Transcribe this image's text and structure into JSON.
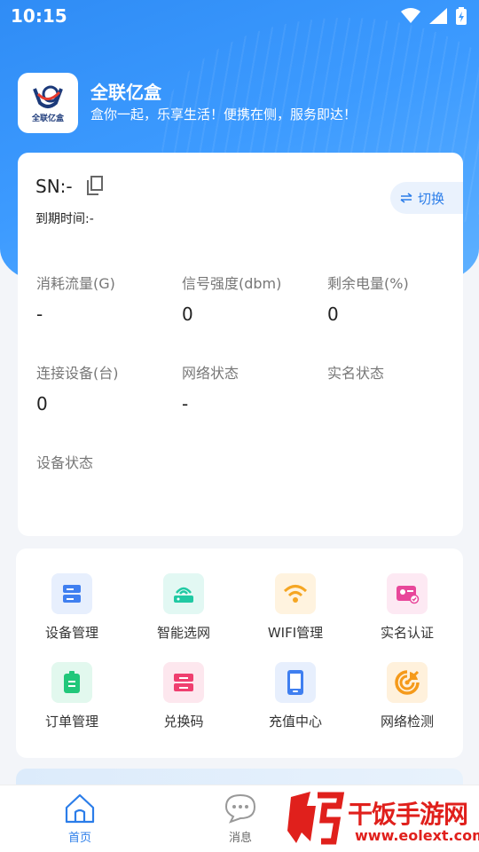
{
  "status_bar": {
    "time": "10:15"
  },
  "app": {
    "name": "全联亿盒",
    "slogan": "盒你一起，乐享生活！便携在侧，服务即达！",
    "logo_text": "全联亿盒"
  },
  "device": {
    "sn_label": "SN:-",
    "expire_label": "到期时间:-",
    "switch_label": "切换"
  },
  "stats": [
    {
      "label": "消耗流量(G)",
      "value": "-"
    },
    {
      "label": "信号强度(dbm)",
      "value": "0"
    },
    {
      "label": "剩余电量(%)",
      "value": "0"
    },
    {
      "label": "连接设备(台)",
      "value": "0"
    },
    {
      "label": "网络状态",
      "value": "-"
    },
    {
      "label": "实名状态",
      "value": ""
    },
    {
      "label": "设备状态",
      "value": ""
    }
  ],
  "menu": [
    {
      "label": "设备管理",
      "icon": "device-icon",
      "bg": "#e7effd",
      "color": "#3f7ff0"
    },
    {
      "label": "智能选网",
      "icon": "router-icon",
      "bg": "#e2f8f3",
      "color": "#20c9a3"
    },
    {
      "label": "WIFI管理",
      "icon": "wifi-icon",
      "bg": "#fff3df",
      "color": "#f5a623"
    },
    {
      "label": "实名认证",
      "icon": "id-card-icon",
      "bg": "#fde9f3",
      "color": "#e8479a"
    },
    {
      "label": "订单管理",
      "icon": "order-icon",
      "bg": "#e2f8ee",
      "color": "#21c77a"
    },
    {
      "label": "兑换码",
      "icon": "coupon-icon",
      "bg": "#fde7ee",
      "color": "#ef3f6f"
    },
    {
      "label": "充值中心",
      "icon": "phone-icon",
      "bg": "#e7effd",
      "color": "#3f7ff0"
    },
    {
      "label": "网络检测",
      "icon": "radar-icon",
      "bg": "#fff1dc",
      "color": "#f59a1b"
    }
  ],
  "tabs": [
    {
      "label": "首页",
      "icon": "home-icon",
      "active": true
    },
    {
      "label": "消息",
      "icon": "message-icon",
      "active": false
    }
  ],
  "watermark": {
    "text": "干饭手游网",
    "url": "www.eolext.com"
  },
  "colors": {
    "primary": "#2f8cf5",
    "accent": "#2b7de9",
    "tab_active": "#2b7de9",
    "watermark": "#e0201c"
  }
}
